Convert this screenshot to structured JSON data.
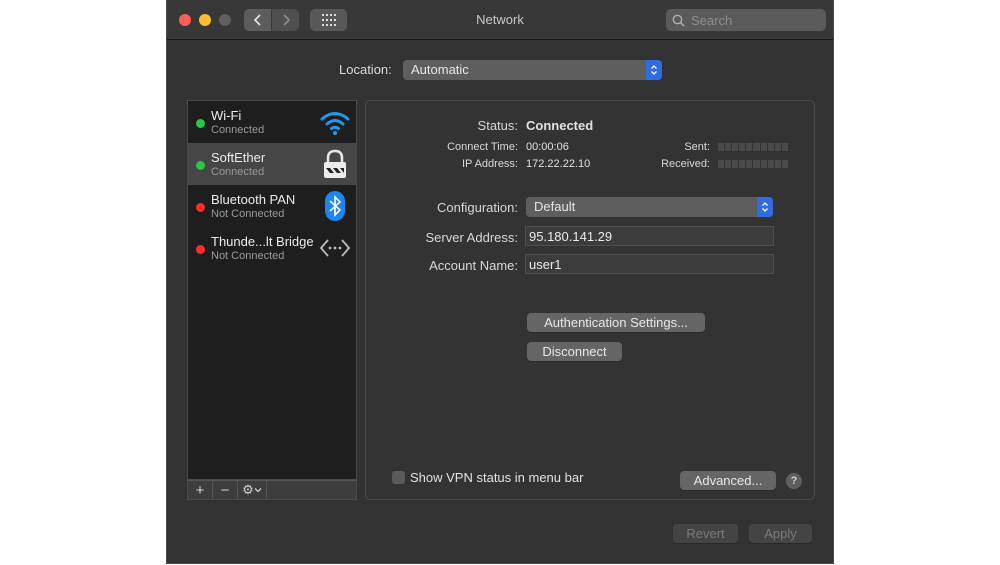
{
  "window": {
    "title": "Network"
  },
  "toolbar": {
    "search_placeholder": "Search"
  },
  "location": {
    "label": "Location:",
    "value": "Automatic"
  },
  "services": [
    {
      "name": "Wi-Fi",
      "status": "Connected",
      "status_color": "#28c840",
      "icon": "wifi-icon",
      "selected": false
    },
    {
      "name": "SoftEther",
      "status": "Connected",
      "status_color": "#28c840",
      "icon": "lock-icon",
      "selected": true
    },
    {
      "name": "Bluetooth PAN",
      "status": "Not Connected",
      "status_color": "#ff2a2a",
      "icon": "bluetooth-icon",
      "selected": false
    },
    {
      "name": "Thunde...lt Bridge",
      "status": "Not Connected",
      "status_color": "#ff2a2a",
      "icon": "bridge-icon",
      "selected": false
    }
  ],
  "sidebar_controls": {
    "add": "+",
    "remove": "−",
    "action": "⚙"
  },
  "detail": {
    "status_label": "Status:",
    "status_value": "Connected",
    "connect_time_label": "Connect Time:",
    "connect_time_value": "00:00:06",
    "ip_label": "IP Address:",
    "ip_value": "172.22.22.10",
    "sent_label": "Sent:",
    "received_label": "Received:",
    "sent_level": 0,
    "received_level": 0,
    "configuration_label": "Configuration:",
    "configuration_value": "Default",
    "server_label": "Server Address:",
    "server_value": "95.180.141.29",
    "account_label": "Account Name:",
    "account_value": "user1",
    "auth_button": "Authentication Settings...",
    "disconnect_button": "Disconnect",
    "show_vpn_label": "Show VPN status in menu bar",
    "show_vpn_checked": false,
    "advanced_button": "Advanced...",
    "help": "?"
  },
  "footer": {
    "revert": "Revert",
    "apply": "Apply"
  }
}
